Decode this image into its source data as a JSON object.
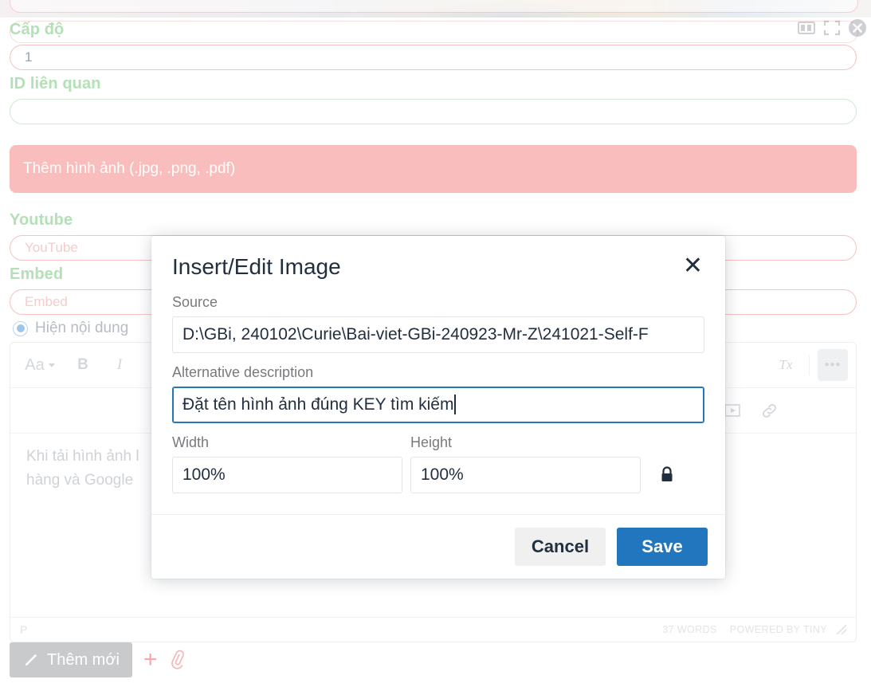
{
  "background_form": {
    "fields": [
      {
        "label": "Cấp độ",
        "value": "1",
        "placeholder": "",
        "border": "pink"
      },
      {
        "label": "ID liên quan",
        "value": "",
        "placeholder": "",
        "border": "green"
      }
    ],
    "upload_button": {
      "label": "Thêm hình ảnh (.jpg, .png, .pdf)",
      "color": "#f9bdbd"
    },
    "youtube": {
      "label": "Youtube",
      "value": "",
      "placeholder": "YouTube"
    },
    "embed": {
      "label": "Embed",
      "value": "",
      "placeholder": "Embed"
    },
    "show_content_radio": {
      "label": "Hiện nội dung",
      "selected": true
    }
  },
  "window_controls": [
    {
      "name": "split-view-icon",
      "title": "Split view"
    },
    {
      "name": "fullscreen-icon",
      "title": "Fullscreen"
    },
    {
      "name": "close-icon",
      "title": "Close"
    }
  ],
  "editor": {
    "toolbar_row1": [
      {
        "icon": "format-aa-icon",
        "label": "Aa",
        "chevron": true
      },
      {
        "icon": "bold-icon",
        "label": "B"
      },
      {
        "icon": "italic-icon",
        "label": "I"
      },
      {
        "icon": "clear-formatting-icon",
        "label": "Tx"
      },
      {
        "icon": "more-options-icon",
        "label": "•••",
        "active": true
      }
    ],
    "toolbar_row2": [
      {
        "icon": "insert-media-icon",
        "label": "▶"
      },
      {
        "icon": "insert-link-icon",
        "label": "🔗"
      }
    ],
    "body_lines": [
      "Khi tải hình ảnh l",
      "hàng và Google"
    ],
    "status": {
      "element_path": "P",
      "word_count": "37 WORDS",
      "branding": "POWERED BY TINY"
    }
  },
  "bottom_bar": {
    "add_new_label": "Thêm mới",
    "add_new_icon": "pen-icon",
    "plus_icon": "plus-icon",
    "attach_icon": "paperclip-icon"
  },
  "modal": {
    "title": "Insert/Edit Image",
    "close_label": "✕",
    "source": {
      "label": "Source",
      "value": "D:\\GBi, 240102\\Curie\\Bai-viet-GBi-240923-Mr-Z\\241021-Self-F",
      "placeholder": ""
    },
    "alt": {
      "label": "Alternative description",
      "value": "Đặt tên hình ảnh đúng KEY tìm kiếm",
      "placeholder": "",
      "focused": true
    },
    "width": {
      "label": "Width",
      "value": "100%"
    },
    "height": {
      "label": "Height",
      "value": "100%"
    },
    "constrain_icon": "lock-closed-icon",
    "buttons": {
      "cancel": "Cancel",
      "save": "Save"
    },
    "accent_color": "#2276bd"
  }
}
